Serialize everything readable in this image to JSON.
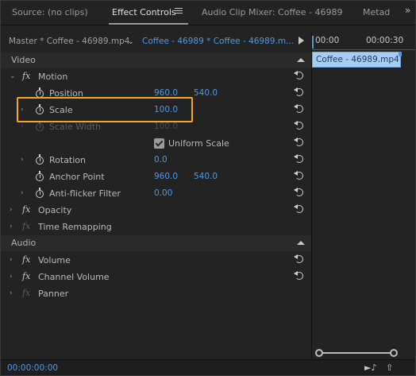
{
  "tabs": [
    {
      "label": "Source: (no clips)"
    },
    {
      "label": "Effect Controls"
    },
    {
      "label": "Audio Clip Mixer: Coffee - 46989"
    },
    {
      "label": "Metad"
    }
  ],
  "more_icon": "»",
  "header": {
    "master_label": "Master * Coffee - 46989.mp4",
    "clip_label": "Coffee - 46989 * Coffee - 46989.m..."
  },
  "sections": {
    "video": "Video",
    "audio": "Audio"
  },
  "rows": {
    "motion": {
      "name": "Motion"
    },
    "position": {
      "name": "Position",
      "x": "960.0",
      "y": "540.0"
    },
    "scale": {
      "name": "Scale",
      "value": "100.0"
    },
    "scale_width": {
      "name": "Scale Width",
      "value": "100.0"
    },
    "uniform_scale": {
      "name": "Uniform Scale",
      "checked": true
    },
    "rotation": {
      "name": "Rotation",
      "value": "0.0"
    },
    "anchor_point": {
      "name": "Anchor Point",
      "x": "960.0",
      "y": "540.0"
    },
    "anti_flicker": {
      "name": "Anti-flicker Filter",
      "value": "0.00"
    },
    "opacity": {
      "name": "Opacity"
    },
    "time_remapping": {
      "name": "Time Remapping"
    },
    "volume": {
      "name": "Volume"
    },
    "channel_volume": {
      "name": "Channel Volume"
    },
    "panner": {
      "name": "Panner"
    }
  },
  "timeline": {
    "time_start": "00:00",
    "time_end": "00:00:30",
    "clip_name": "Coffee - 46989.mp4"
  },
  "footer": {
    "timecode": "00:00:00:00"
  },
  "colors": {
    "accent_blue": "#4d9be6",
    "highlight": "#f5a623",
    "clip_bar": "#a8cdf2"
  }
}
